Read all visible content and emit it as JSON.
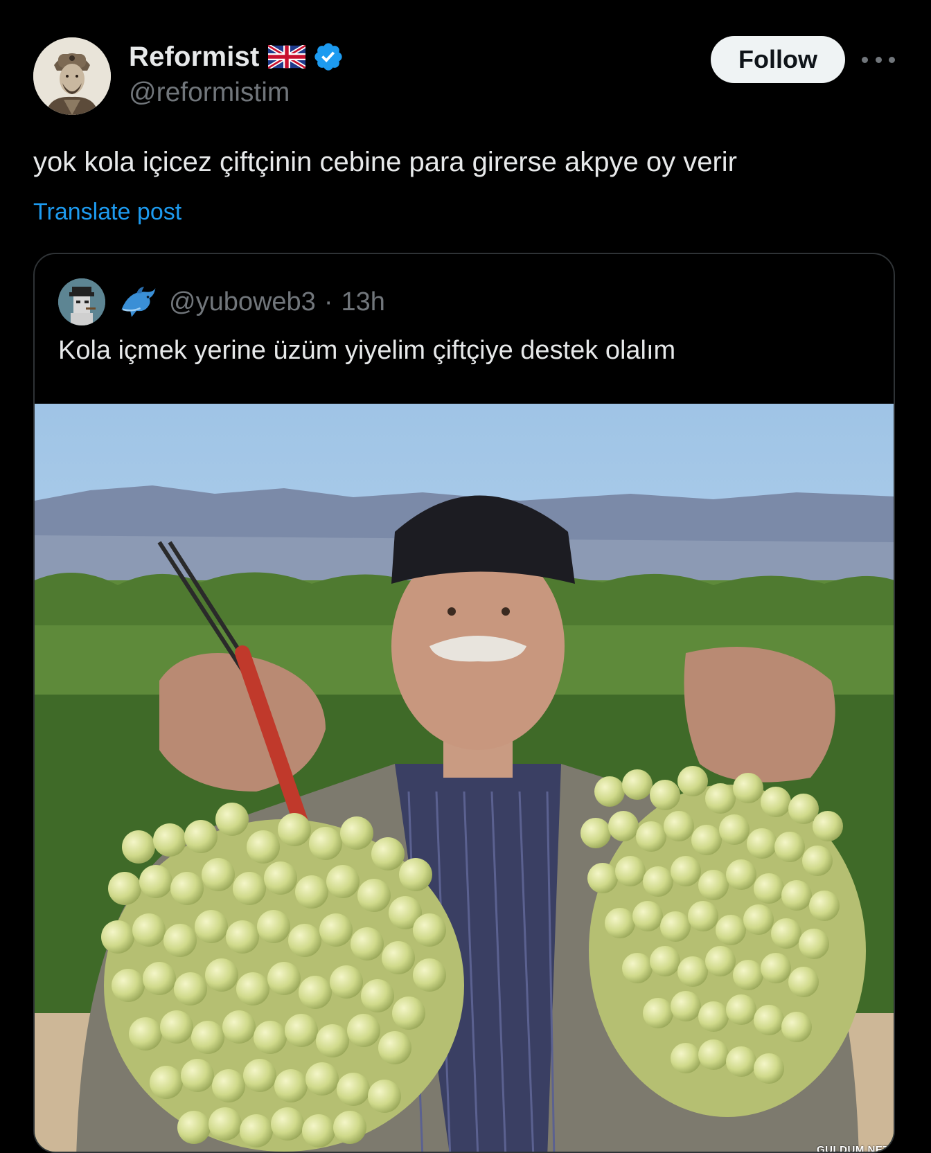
{
  "author": {
    "display_name": "Reformist",
    "handle": "@reformistim",
    "flag_icon": "uk-flag-icon",
    "verified_icon": "verified-badge-icon",
    "verified_color": "#1d9bf0"
  },
  "follow_button": {
    "label": "Follow"
  },
  "more_icon": "more-horizontal-icon",
  "post": {
    "text": "yok kola içicez çiftçinin cebine para girerse akpye oy verir",
    "translate_label": "Translate post"
  },
  "quoted": {
    "handle": "@yuboweb3",
    "separator": "·",
    "time": "13h",
    "badge_icon": "dolphin-icon",
    "text": "Kola içmek yerine üzüm yiyelim çiftçiye destek olalım",
    "image_alt": "farmer-holding-grapes-photo"
  },
  "watermark": "GULDUM.NET",
  "colors": {
    "background": "#000000",
    "text": "#e7e9ea",
    "muted": "#71767b",
    "link": "#1d9bf0",
    "follow_bg": "#eff3f4",
    "border": "#2f3336"
  }
}
